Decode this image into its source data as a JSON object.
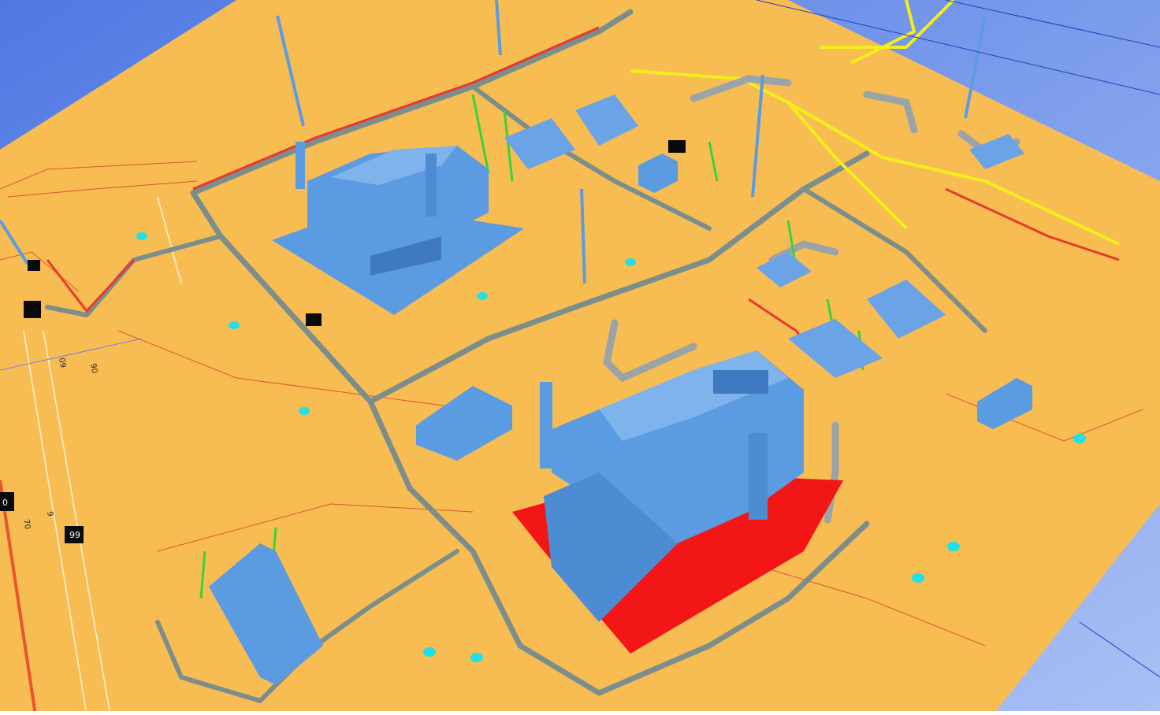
{
  "viewport": {
    "background_top": "#5b83e6",
    "background_bottom": "#9fb8f2",
    "ground_color": "#f7bd53"
  },
  "colors": {
    "equipment": "#5b9be2",
    "equipment_dark": "#3f79c0",
    "pipe_rack": "#7c8e8b",
    "steel_red": "#e8392c",
    "steel_green": "#3bd13b",
    "pipe_yellow": "#f4ee1a",
    "pipe_grey": "#9aa4a8",
    "marker_cyan": "#20e0e8",
    "skid_red": "#f21616"
  },
  "labels": {
    "grid_numbers": [
      "90",
      "09",
      "70",
      "9"
    ],
    "tags": [
      "99",
      "0"
    ]
  }
}
